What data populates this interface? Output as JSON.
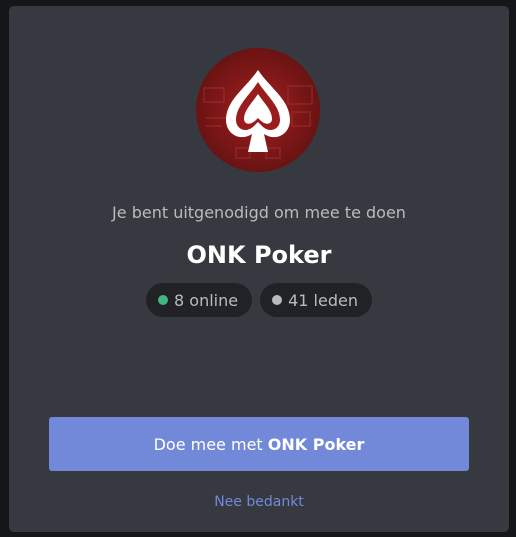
{
  "invite": {
    "subtitle": "Je bent uitgenodigd om mee te doen",
    "server_name": "ONK Poker",
    "icon": "spade-icon",
    "online_count": "8 online",
    "member_count": "41 leden",
    "join_label_prefix": "Doe mee met ",
    "join_label_server": "ONK Poker",
    "decline_label": "Nee bedankt"
  },
  "colors": {
    "accent": "#7289da",
    "online": "#43b581",
    "offline": "#b9bbbe",
    "modal_bg": "#36393f",
    "pill_bg": "#202225",
    "icon_bg": "#8b1a1a"
  }
}
